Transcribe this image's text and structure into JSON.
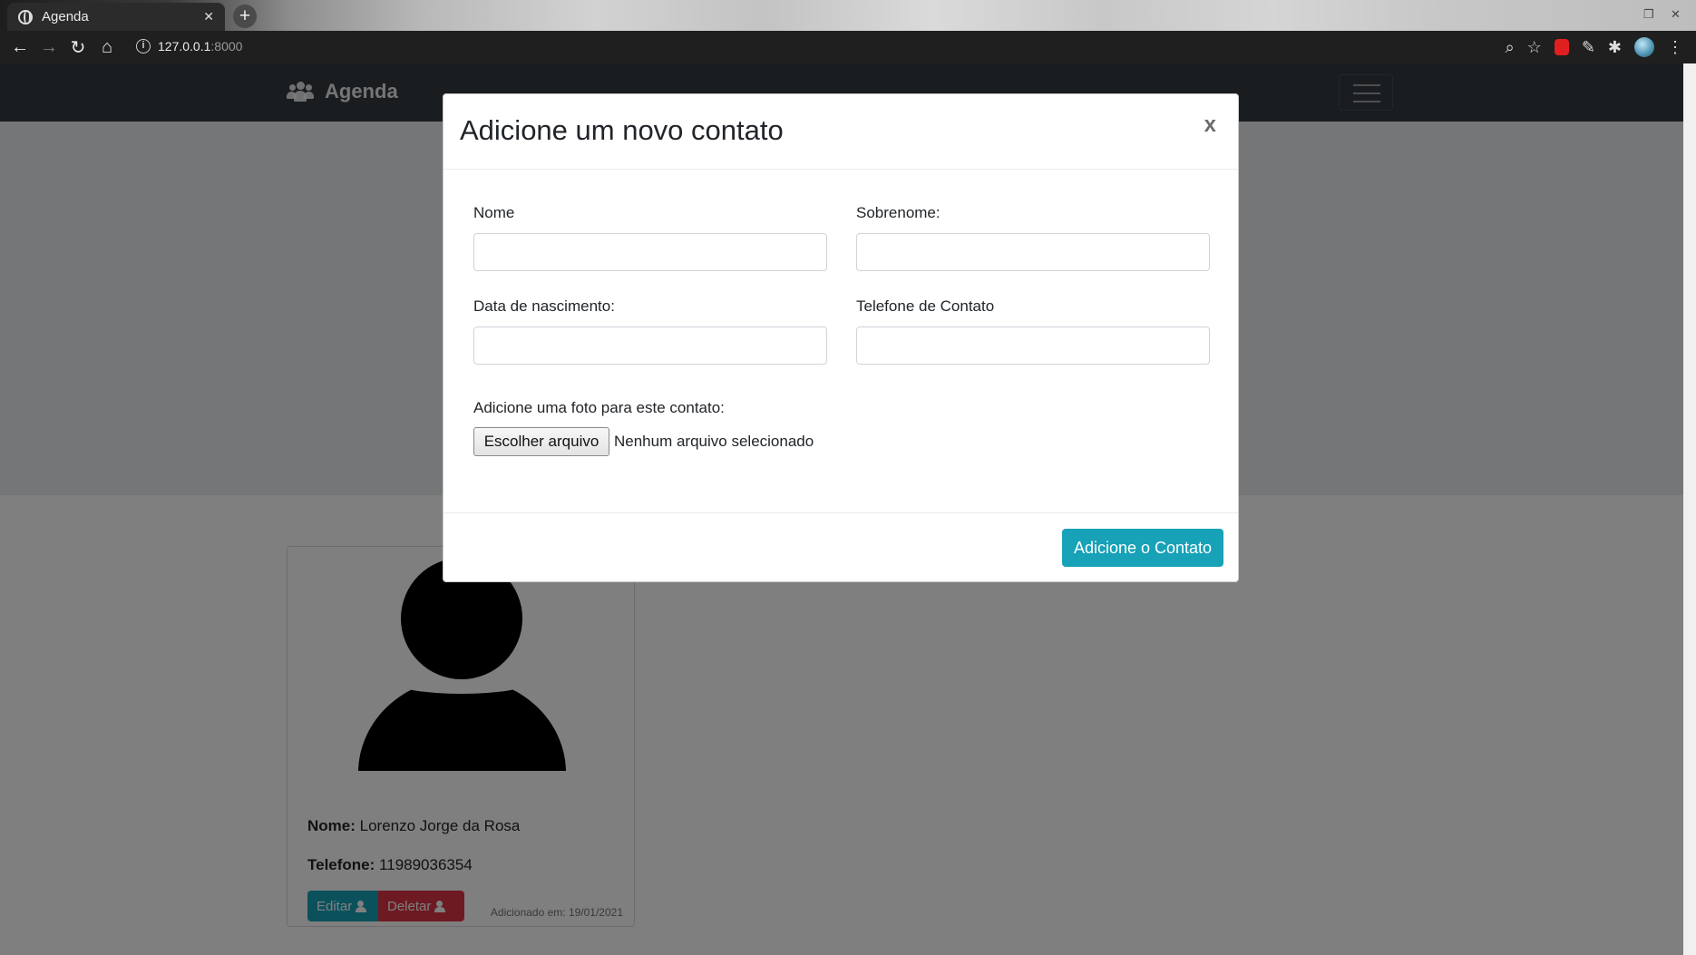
{
  "browser": {
    "tab_title": "Agenda",
    "tab_close": "✕",
    "new_tab": "+",
    "url_host": "127.0.0.1",
    "url_port": ":8000"
  },
  "navbar": {
    "brand": "Agenda"
  },
  "card": {
    "name_label": "Nome:",
    "name_value": "Lorenzo Jorge da Rosa",
    "phone_label": "Telefone:",
    "phone_value": "11989036354",
    "edit_label": "Editar",
    "delete_label": "Deletar",
    "added_text": "Adicionado em: 19/01/2021"
  },
  "modal": {
    "title": "Adicione um novo contato",
    "close": "x",
    "fields": {
      "nome_label": "Nome",
      "nome_value": "",
      "sobrenome_label": "Sobrenome:",
      "sobrenome_value": "",
      "nascimento_label": "Data de nascimento:",
      "nascimento_value": "",
      "telefone_label": "Telefone de Contato",
      "telefone_value": ""
    },
    "photo_label": "Adicione uma foto para este contato:",
    "file_button": "Escolher arquivo",
    "file_status": "Nenhum arquivo selecionado",
    "submit": "Adicione o Contato"
  },
  "colors": {
    "navbar_bg": "#343a40",
    "info": "#17a2b8",
    "danger": "#dc3545"
  }
}
